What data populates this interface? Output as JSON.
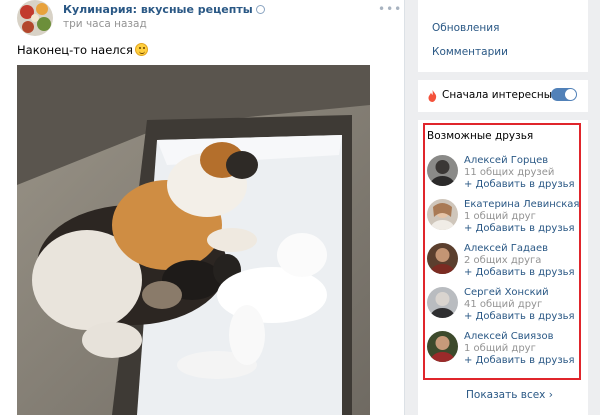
{
  "post": {
    "group_name": "Кулинария: вкусные рецепты",
    "time": "три часа назад",
    "more": "•••",
    "text": "Наконец-то наелся"
  },
  "menu": {
    "items": [
      {
        "label": "Обновления"
      },
      {
        "label": "Комментарии"
      }
    ]
  },
  "sort": {
    "label": "Сначала интересные",
    "enabled": true
  },
  "friends": {
    "title": "Возможные друзья",
    "add_label": "+ Добавить в друзья",
    "items": [
      {
        "name": "Алексей Горцев",
        "mutual": "11 общих друзей"
      },
      {
        "name": "Екатерина Левинская",
        "mutual": "1 общий друг"
      },
      {
        "name": "Алексей Гадаев",
        "mutual": "2 общих друга"
      },
      {
        "name": "Сергей Хонский",
        "mutual": "41 общий друг"
      },
      {
        "name": "Алексей Свиязов",
        "mutual": "1 общий друг"
      }
    ],
    "show_all": "Показать всех ›"
  },
  "colors": {
    "link": "#2a5885",
    "muted": "#939393",
    "accent": "#5181b8",
    "highlight_border": "#e0252b"
  }
}
